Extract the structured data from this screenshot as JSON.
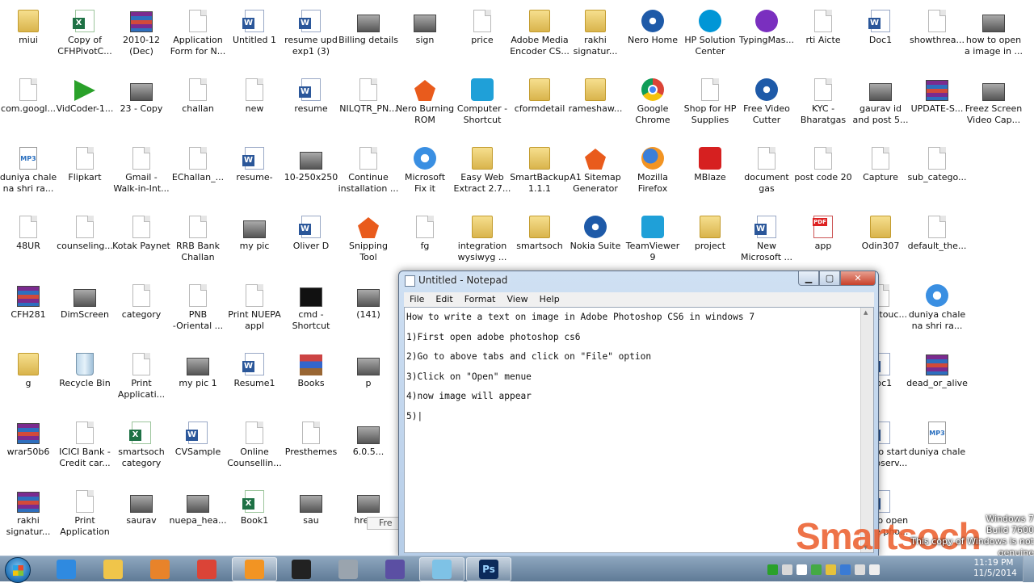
{
  "desktop": {
    "icons": [
      {
        "label": "miui",
        "glyph": "folder"
      },
      {
        "label": "Copy of\nCFHPivotC...",
        "glyph": "excel"
      },
      {
        "label": "2010-12\n(Dec)",
        "glyph": "rar"
      },
      {
        "label": "Application\nForm for N...",
        "glyph": "doc"
      },
      {
        "label": "Untitled 1",
        "glyph": "word"
      },
      {
        "label": "resume upd\nexp1 (3)",
        "glyph": "word"
      },
      {
        "label": "Billing details",
        "glyph": "img"
      },
      {
        "label": "sign",
        "glyph": "img"
      },
      {
        "label": "price",
        "glyph": "doc"
      },
      {
        "label": "Adobe Media\nEncoder CS...",
        "glyph": "folder"
      },
      {
        "label": "rakhi\nsignatur...",
        "glyph": "folder"
      },
      {
        "label": "Nero Home",
        "glyph": "nero"
      },
      {
        "label": "HP Solution\nCenter",
        "glyph": "hp"
      },
      {
        "label": "TypingMas...",
        "glyph": "purple"
      },
      {
        "label": "rti Aicte",
        "glyph": "doc"
      },
      {
        "label": "Doc1",
        "glyph": "word"
      },
      {
        "label": "showthrea...",
        "glyph": "doc"
      },
      {
        "label": "how to open\na image in ...",
        "glyph": "img"
      },
      {
        "label": "com.googl...",
        "glyph": "doc"
      },
      {
        "label": "VidCoder-1...",
        "glyph": "green"
      },
      {
        "label": "23 - Copy",
        "glyph": "img"
      },
      {
        "label": "challan",
        "glyph": "doc"
      },
      {
        "label": "new",
        "glyph": "doc"
      },
      {
        "label": "resume",
        "glyph": "word"
      },
      {
        "label": "NILQTR_PN...",
        "glyph": "doc"
      },
      {
        "label": "Nero Burning\nROM",
        "glyph": "shot"
      },
      {
        "label": "Computer -\nShortcut",
        "glyph": "teal"
      },
      {
        "label": "cformdetail",
        "glyph": "folder"
      },
      {
        "label": "rameshaw...",
        "glyph": "folder"
      },
      {
        "label": "Google\nChrome",
        "glyph": "chrome"
      },
      {
        "label": "Shop for HP\nSupplies",
        "glyph": "doc"
      },
      {
        "label": "Free Video\nCutter",
        "glyph": "nero"
      },
      {
        "label": "KYC -\nBharatgas",
        "glyph": "doc"
      },
      {
        "label": "gaurav id\nand post 5...",
        "glyph": "img"
      },
      {
        "label": "UPDATE-S...",
        "glyph": "rar"
      },
      {
        "label": "Freez Screen\nVideo Cap...",
        "glyph": "img"
      },
      {
        "label": "duniya chale\nna shri ra...",
        "glyph": "mp3"
      },
      {
        "label": "Flipkart",
        "glyph": "doc"
      },
      {
        "label": "Gmail -\nWalk-in-Int...",
        "glyph": "doc"
      },
      {
        "label": "EChallan_...",
        "glyph": "doc"
      },
      {
        "label": "resume-",
        "glyph": "word"
      },
      {
        "label": "10-250x250",
        "glyph": "img"
      },
      {
        "label": "Continue\ninstallation ...",
        "glyph": "doc"
      },
      {
        "label": "Microsoft\nFix it",
        "glyph": "ie"
      },
      {
        "label": "Easy Web\nExtract 2.7...",
        "glyph": "folder"
      },
      {
        "label": "SmartBackup\n1.1.1",
        "glyph": "folder"
      },
      {
        "label": "A1 Sitemap\nGenerator",
        "glyph": "shot"
      },
      {
        "label": "Mozilla\nFirefox",
        "glyph": "firefox"
      },
      {
        "label": "MBlaze",
        "glyph": "red"
      },
      {
        "label": "document\ngas",
        "glyph": "doc"
      },
      {
        "label": "post code 20",
        "glyph": "doc"
      },
      {
        "label": "Capture",
        "glyph": "doc"
      },
      {
        "label": "sub_catego...",
        "glyph": "doc"
      },
      {
        "label": "48UR",
        "glyph": "doc"
      },
      {
        "label": "counseling...",
        "glyph": "doc"
      },
      {
        "label": "Kotak Paynet",
        "glyph": "doc"
      },
      {
        "label": "RRB Bank\nChallan",
        "glyph": "doc"
      },
      {
        "label": "my pic",
        "glyph": "img"
      },
      {
        "label": "Oliver D",
        "glyph": "word"
      },
      {
        "label": "Snipping\nTool",
        "glyph": "shot"
      },
      {
        "label": "fg",
        "glyph": "doc"
      },
      {
        "label": "integration\nwysiwyg ...",
        "glyph": "folder"
      },
      {
        "label": "smartsoch",
        "glyph": "folder"
      },
      {
        "label": "Nokia Suite",
        "glyph": "nero"
      },
      {
        "label": "TeamViewer\n9",
        "glyph": "teal"
      },
      {
        "label": "project",
        "glyph": "folder"
      },
      {
        "label": "New\nMicrosoft ...",
        "glyph": "word"
      },
      {
        "label": "app",
        "glyph": "pdf"
      },
      {
        "label": "Odin307",
        "glyph": "folder"
      },
      {
        "label": "default_the...",
        "glyph": "doc"
      },
      {
        "label": "CFH281",
        "glyph": "rar"
      },
      {
        "label": "DimScreen",
        "glyph": "img"
      },
      {
        "label": "category",
        "glyph": "doc"
      },
      {
        "label": "PNB\n-Oriental ...",
        "glyph": "doc"
      },
      {
        "label": "Print NUEPA\nappl",
        "glyph": "doc"
      },
      {
        "label": "cmd -\nShortcut",
        "glyph": "blackwin"
      },
      {
        "label": "(141)",
        "glyph": "img"
      },
      {
        "label": "philz_touc...",
        "glyph": "doc"
      },
      {
        "label": "duniya chale\nna shri ra...",
        "glyph": "ie"
      },
      {
        "label": "g",
        "glyph": "folder"
      },
      {
        "label": "Recycle Bin",
        "glyph": "bin"
      },
      {
        "label": "Print\nApplicati...",
        "glyph": "doc"
      },
      {
        "label": "my pic 1",
        "glyph": "img"
      },
      {
        "label": "Resume1",
        "glyph": "word"
      },
      {
        "label": "Books",
        "glyph": "books"
      },
      {
        "label": "p",
        "glyph": "img"
      },
      {
        "label": "Doc1",
        "glyph": "word"
      },
      {
        "label": "dead_or_alive",
        "glyph": "rar"
      },
      {
        "label": "wrar50b6",
        "glyph": "rar"
      },
      {
        "label": "ICICI Bank -\nCredit car...",
        "glyph": "doc"
      },
      {
        "label": "smartsoch\ncategory",
        "glyph": "excel"
      },
      {
        "label": "CVSample",
        "glyph": "word"
      },
      {
        "label": "Online\nCounsellin...",
        "glyph": "doc"
      },
      {
        "label": "Presthemes",
        "glyph": "doc"
      },
      {
        "label": "6.0.5...",
        "glyph": "img"
      },
      {
        "label": "how to start\nwempserv...",
        "glyph": "word"
      },
      {
        "label": "duniya chale",
        "glyph": "mp3"
      },
      {
        "label": "rakhi\nsignatur...",
        "glyph": "rar"
      },
      {
        "label": "Print\nApplication",
        "glyph": "doc"
      },
      {
        "label": "saurav",
        "glyph": "img"
      },
      {
        "label": "nuepa_hea...",
        "glyph": "img"
      },
      {
        "label": "Book1",
        "glyph": "excel"
      },
      {
        "label": "sau",
        "glyph": "img"
      },
      {
        "label": "hrea...",
        "glyph": "img"
      },
      {
        "label": "how to open\nadobe pho...",
        "glyph": "word"
      }
    ]
  },
  "notepad": {
    "title": "Untitled - Notepad",
    "minimize": "▁",
    "maximize": "▢",
    "close": "✕",
    "menu": [
      "File",
      "Edit",
      "Format",
      "View",
      "Help"
    ],
    "lines": [
      "How to write a text on image in Adobe Photoshop CS6 in windows 7",
      "1)First open adobe photoshop cs6",
      "2)Go to above tabs and click on \"File\" option",
      "3)Click on \"Open\" menue",
      "4)now image will appear",
      "5)|"
    ]
  },
  "behind_window_label": "Fre",
  "taskbar": {
    "items": [
      {
        "name": "ie",
        "color": "#2f8ae0",
        "active": false
      },
      {
        "name": "explorer",
        "color": "#f0c54a",
        "active": false
      },
      {
        "name": "media-player",
        "color": "#e8832a",
        "active": false
      },
      {
        "name": "chrome",
        "color": "#db4437",
        "active": false
      },
      {
        "name": "firefox",
        "color": "#f29423",
        "active": true
      },
      {
        "name": "dimscreen",
        "color": "#222222",
        "active": false
      },
      {
        "name": "camera",
        "color": "#9aa4ae",
        "active": false
      },
      {
        "name": "nero",
        "color": "#5b4fa3",
        "active": false
      },
      {
        "name": "notepad",
        "color": "#7ec2e6",
        "active": true
      },
      {
        "name": "photoshop",
        "color": "#0b2a5a",
        "active": true
      }
    ],
    "photoshop_label": "Ps",
    "clock_time": "11:19 PM",
    "clock_date": "11/5/2014"
  },
  "watermark": {
    "logo": "Smartsoch",
    "notice_line1": "Windows 7",
    "notice_line2": "Build 7600",
    "notice_line3": "This copy of Windows is not genuine"
  },
  "colors": {
    "taskbar": "#6f8aa6",
    "notepad_frame": "#c3d6ec",
    "close_button": "#c7402a"
  }
}
